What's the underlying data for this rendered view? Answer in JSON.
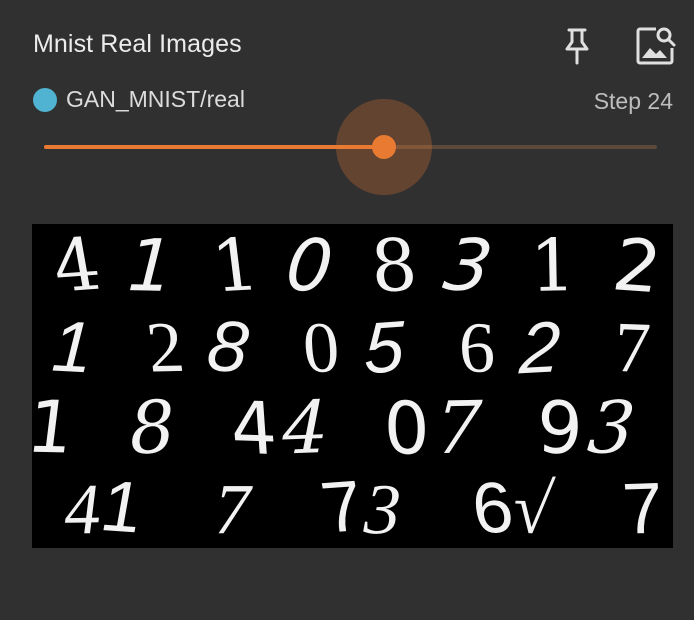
{
  "card": {
    "title": "Mnist Real Images",
    "pin_icon": "pin-icon",
    "image_search_icon": "image-search-icon"
  },
  "run": {
    "name": "GAN_MNIST/real",
    "color": "#4fb3d1"
  },
  "step": {
    "label": "Step 24",
    "value": 24
  },
  "slider": {
    "position_fraction": 0.555,
    "accent": "#e97a32"
  },
  "image": {
    "grid_digits": [
      [
        "4",
        "1",
        "1",
        "0",
        "8",
        "3",
        "1",
        "2"
      ],
      [
        "1",
        "2",
        "8",
        "0",
        "5",
        "6",
        "2",
        "7"
      ],
      [
        "1",
        "8",
        "4",
        "4",
        "0",
        "7",
        "9",
        "3"
      ],
      [
        "4",
        "1",
        "7",
        "7",
        "3",
        "6",
        "√",
        "7"
      ]
    ]
  }
}
